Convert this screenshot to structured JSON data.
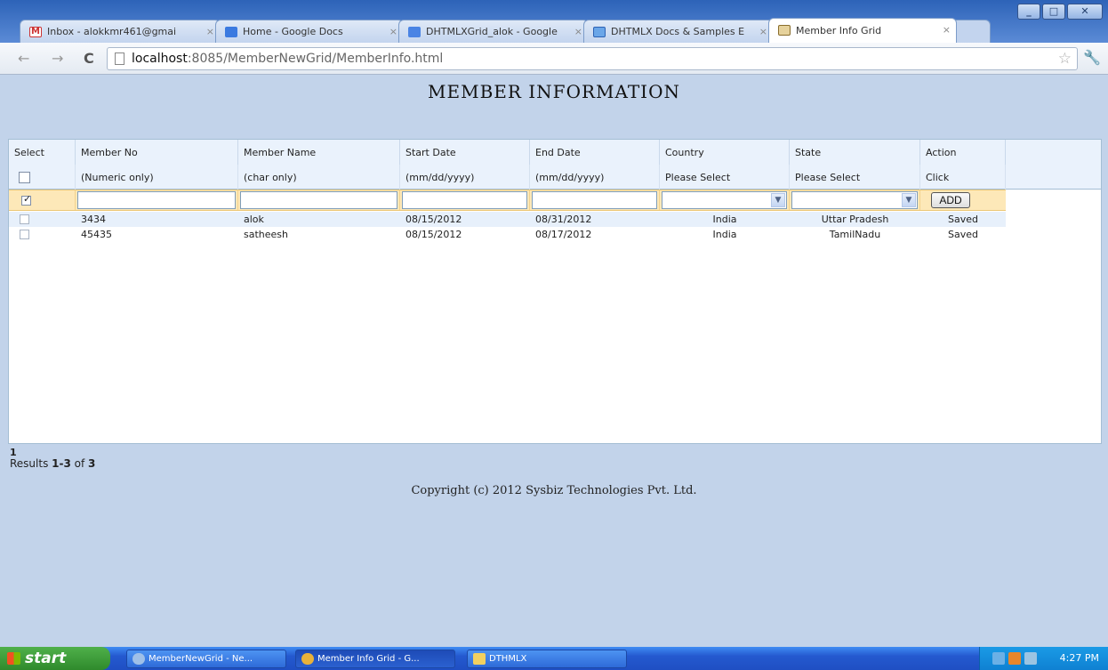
{
  "browser": {
    "tabs": [
      {
        "label": "Inbox - alokkmr461@gmai",
        "icon": "gmail-icon",
        "active": false
      },
      {
        "label": "Home - Google Docs",
        "icon": "docs-home-icon",
        "active": false
      },
      {
        "label": "DHTMLXGrid_alok - Google",
        "icon": "docs-doc-icon",
        "active": false
      },
      {
        "label": "DHTMLX Docs & Samples E",
        "icon": "dhtmlx-icon",
        "active": false
      },
      {
        "label": "Member Info Grid",
        "icon": "page-favicon-icon",
        "active": true
      }
    ],
    "tab_close": "×",
    "url_host": "localhost",
    "url_path": ":8085/MemberNewGrid/MemberInfo.html"
  },
  "page": {
    "title": "MEMBER INFORMATION",
    "copyright": "Copyright (c) 2012 Sysbiz Technologies Pvt. Ltd."
  },
  "grid": {
    "columns": [
      "Select",
      "Member No",
      "Member Name",
      "Start Date",
      "End Date",
      "Country",
      "State",
      "Action"
    ],
    "hints": [
      "(Numeric only)",
      "(char only)",
      "(mm/dd/yyyy)",
      "(mm/dd/yyyy)",
      "Please Select",
      "Please Select",
      "Click"
    ],
    "add_button": "ADD",
    "rows": [
      {
        "checked": false,
        "member_no": "3434",
        "member_name": "alok",
        "start_date": "08/15/2012",
        "end_date": "08/31/2012",
        "country": "India",
        "state": "Uttar Pradesh",
        "action": "Saved"
      },
      {
        "checked": false,
        "member_no": "45435",
        "member_name": "satheesh",
        "start_date": "08/15/2012",
        "end_date": "08/17/2012",
        "country": "India",
        "state": "TamilNadu",
        "action": "Saved"
      }
    ]
  },
  "pager": {
    "page": "1",
    "results_prefix": "Results ",
    "results_range": "1-3",
    "results_of": " of ",
    "results_total": "3"
  },
  "taskbar": {
    "start_label": "start",
    "tasks": [
      "MemberNewGrid - Ne...",
      "Member Info Grid - G...",
      "DTHMLX"
    ],
    "clock": "4:27 PM"
  }
}
